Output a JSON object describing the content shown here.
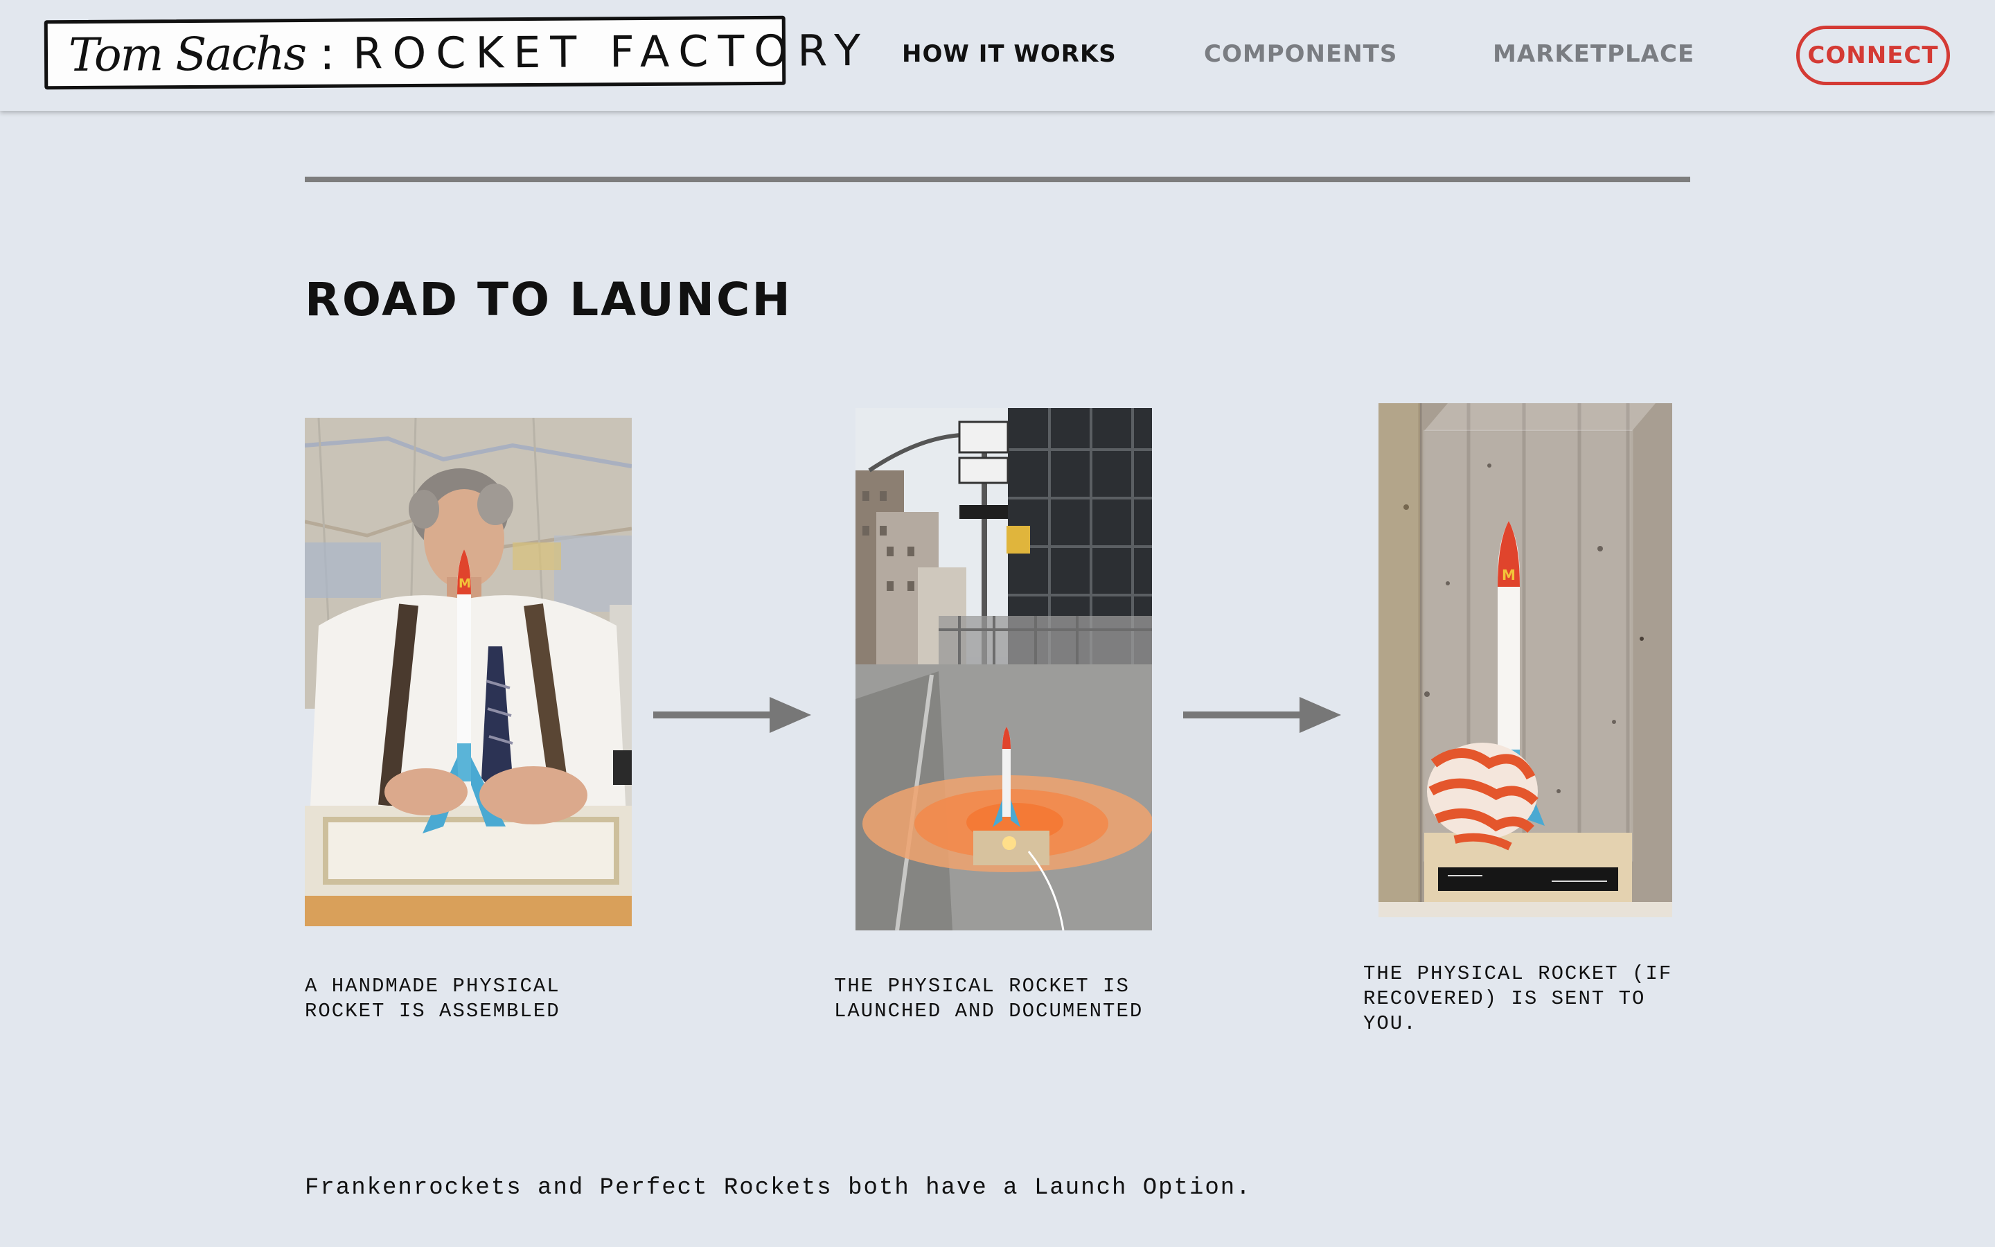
{
  "header": {
    "logo": {
      "signature": "Tom Sachs",
      "separator": ":",
      "wordmark": "ROCKET FACTORY"
    },
    "nav": {
      "how_it_works": "HOW IT WORKS",
      "components": "COMPONENTS",
      "marketplace": "MARKETPLACE"
    },
    "connect_label": "CONNECT"
  },
  "main": {
    "section_title": "ROAD TO LAUNCH",
    "steps": [
      {
        "caption": "A HANDMADE PHYSICAL\nROCKET IS ASSEMBLED",
        "image": "man assembling rocket at desk"
      },
      {
        "caption": "THE PHYSICAL ROCKET IS\nLAUNCHED AND DOCUMENTED",
        "image": "rocket launching on city street"
      },
      {
        "caption": "THE PHYSICAL ROCKET (IF\nRECOVERED) IS SENT TO\nYOU.",
        "image": "recovered rocket in display case"
      }
    ],
    "footnote": "Frankenrockets and Perfect Rockets both have a Launch Option."
  },
  "colors": {
    "background": "#e2e7ee",
    "accent_red": "#d43a34",
    "nav_muted": "#7a7d82",
    "divider": "#7d7d7d"
  },
  "icons": {
    "step_arrow": "arrow-right-icon"
  }
}
